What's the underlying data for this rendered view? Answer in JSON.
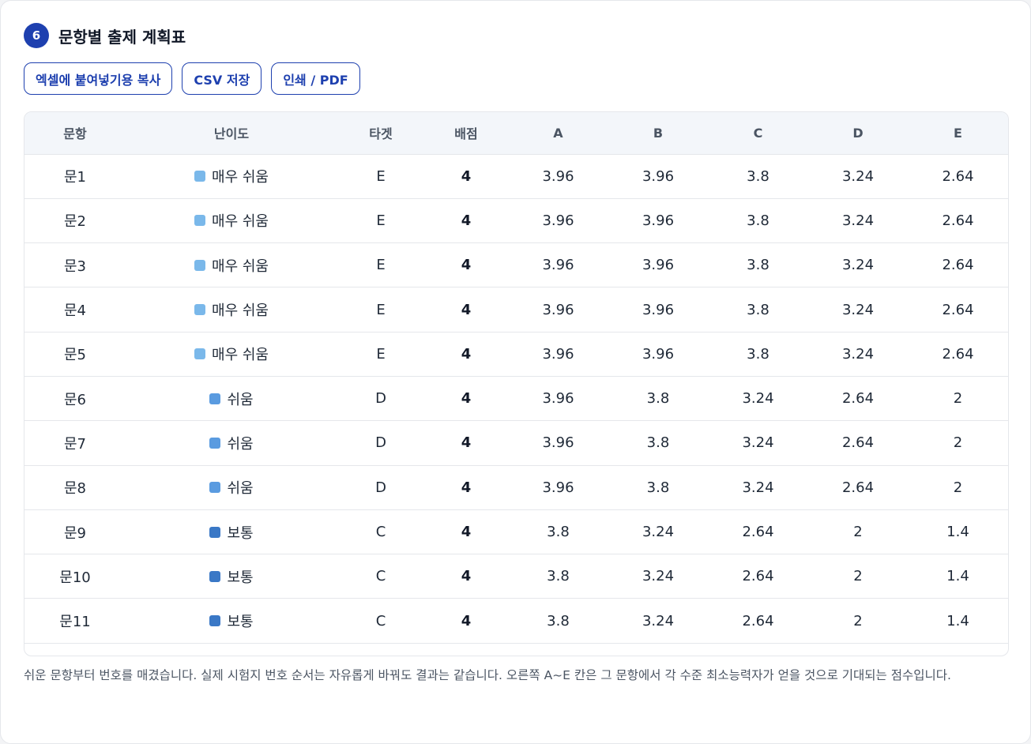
{
  "header": {
    "step": "6",
    "title": "문항별 출제 계획표"
  },
  "toolbar": {
    "copy_label": "엑셀에 붙여넣기용 복사",
    "csv_label": "CSV 저장",
    "print_label": "인쇄 / PDF"
  },
  "table": {
    "columns": [
      "문항",
      "난이도",
      "타겟",
      "배점",
      "A",
      "B",
      "C",
      "D",
      "E"
    ],
    "difficulty_colors": {
      "매우 쉬움": "#7ab8ea",
      "쉬움": "#5a9be0",
      "보통": "#3a78c6"
    },
    "rows": [
      {
        "item": "문1",
        "difficulty": "매우 쉬움",
        "target": "E",
        "score": "4",
        "a": "3.96",
        "b": "3.96",
        "c": "3.8",
        "d": "3.24",
        "e": "2.64"
      },
      {
        "item": "문2",
        "difficulty": "매우 쉬움",
        "target": "E",
        "score": "4",
        "a": "3.96",
        "b": "3.96",
        "c": "3.8",
        "d": "3.24",
        "e": "2.64"
      },
      {
        "item": "문3",
        "difficulty": "매우 쉬움",
        "target": "E",
        "score": "4",
        "a": "3.96",
        "b": "3.96",
        "c": "3.8",
        "d": "3.24",
        "e": "2.64"
      },
      {
        "item": "문4",
        "difficulty": "매우 쉬움",
        "target": "E",
        "score": "4",
        "a": "3.96",
        "b": "3.96",
        "c": "3.8",
        "d": "3.24",
        "e": "2.64"
      },
      {
        "item": "문5",
        "difficulty": "매우 쉬움",
        "target": "E",
        "score": "4",
        "a": "3.96",
        "b": "3.96",
        "c": "3.8",
        "d": "3.24",
        "e": "2.64"
      },
      {
        "item": "문6",
        "difficulty": "쉬움",
        "target": "D",
        "score": "4",
        "a": "3.96",
        "b": "3.8",
        "c": "3.24",
        "d": "2.64",
        "e": "2"
      },
      {
        "item": "문7",
        "difficulty": "쉬움",
        "target": "D",
        "score": "4",
        "a": "3.96",
        "b": "3.8",
        "c": "3.24",
        "d": "2.64",
        "e": "2"
      },
      {
        "item": "문8",
        "difficulty": "쉬움",
        "target": "D",
        "score": "4",
        "a": "3.96",
        "b": "3.8",
        "c": "3.24",
        "d": "2.64",
        "e": "2"
      },
      {
        "item": "문9",
        "difficulty": "보통",
        "target": "C",
        "score": "4",
        "a": "3.8",
        "b": "3.24",
        "c": "2.64",
        "d": "2",
        "e": "1.4"
      },
      {
        "item": "문10",
        "difficulty": "보통",
        "target": "C",
        "score": "4",
        "a": "3.8",
        "b": "3.24",
        "c": "2.64",
        "d": "2",
        "e": "1.4"
      },
      {
        "item": "문11",
        "difficulty": "보통",
        "target": "C",
        "score": "4",
        "a": "3.8",
        "b": "3.24",
        "c": "2.64",
        "d": "2",
        "e": "1.4"
      }
    ]
  },
  "note": "쉬운 문항부터 번호를 매겼습니다. 실제 시험지 번호 순서는 자유롭게 바꿔도 결과는 같습니다. 오른쪽 A~E 칸은 그 문항에서 각 수준 최소능력자가 얻을 것으로 기대되는 점수입니다."
}
